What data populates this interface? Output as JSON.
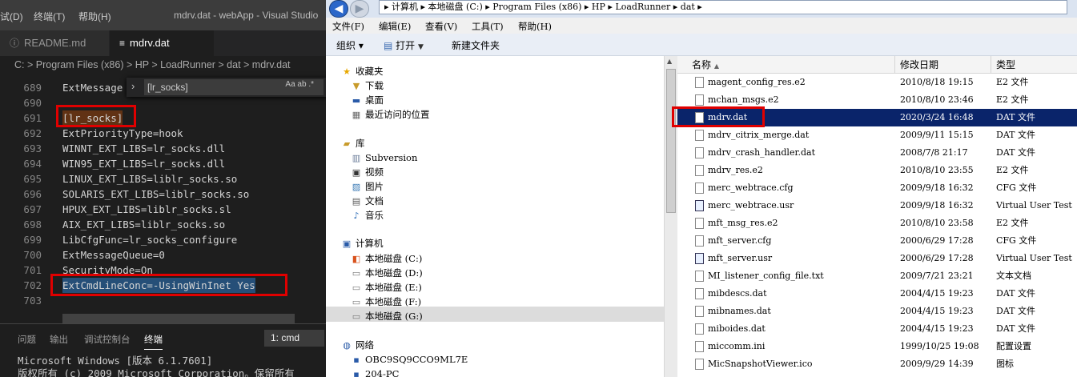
{
  "vscode": {
    "title_menus": [
      "试(D)",
      "终端(T)",
      "帮助(H)"
    ],
    "window_title": "mdrv.dat - webApp - Visual Studio",
    "tabs": [
      {
        "label": "README.md",
        "icon": "info-icon"
      },
      {
        "label": "mdrv.dat",
        "icon": "list-icon"
      }
    ],
    "breadcrumb": "C: > Program Files (x86) > HP > LoadRunner > dat > mdrv.dat",
    "find_text": "[lr_socks]",
    "find_options": "Aa  ab  .*",
    "lines": [
      {
        "n": "689",
        "code": "ExtMessage"
      },
      {
        "n": "690",
        "code": ""
      },
      {
        "n": "691",
        "code": "[lr_socks]"
      },
      {
        "n": "692",
        "code": "ExtPriorityType=hook"
      },
      {
        "n": "693",
        "code": "WINNT_EXT_LIBS=lr_socks.dll"
      },
      {
        "n": "694",
        "code": "WIN95_EXT_LIBS=lr_socks.dll"
      },
      {
        "n": "695",
        "code": "LINUX_EXT_LIBS=liblr_socks.so"
      },
      {
        "n": "696",
        "code": "SOLARIS_EXT_LIBS=liblr_socks.so"
      },
      {
        "n": "697",
        "code": "HPUX_EXT_LIBS=liblr_socks.sl"
      },
      {
        "n": "698",
        "code": "AIX_EXT_LIBS=liblr_socks.so"
      },
      {
        "n": "699",
        "code": "LibCfgFunc=lr_socks_configure"
      },
      {
        "n": "700",
        "code": "ExtMessageQueue=0"
      },
      {
        "n": "701",
        "code": "SecurityMode=On"
      },
      {
        "n": "702",
        "code": "ExtCmdLineConc=-UsingWinInet Yes"
      },
      {
        "n": "703",
        "code": ""
      }
    ],
    "panel_tabs": [
      "问题",
      "输出",
      "调试控制台",
      "终端"
    ],
    "terminal_select": "1: cmd",
    "terminal_lines": [
      "Microsoft Windows [版本 6.1.7601]",
      "版权所有 (c) 2009 Microsoft Corporation。保留所有"
    ]
  },
  "explorer": {
    "address_path": "▸ 计算机 ▸ 本地磁盘 (C:) ▸ Program Files (x86) ▸ HP ▸ LoadRunner ▸ dat ▸",
    "menus": [
      "文件(F)",
      "编辑(E)",
      "查看(V)",
      "工具(T)",
      "帮助(H)"
    ],
    "toolbar": {
      "organize": "组织 ▾",
      "open": "打开",
      "new_folder": "新建文件夹"
    },
    "nav": {
      "favorites_title": "收藏夹",
      "favorites": [
        "下载",
        "桌面",
        "最近访问的位置"
      ],
      "libraries_title": "库",
      "libraries": [
        "Subversion",
        "视频",
        "图片",
        "文档",
        "音乐"
      ],
      "computer_title": "计算机",
      "drives": [
        "本地磁盘 (C:)",
        "本地磁盘 (D:)",
        "本地磁盘 (E:)",
        "本地磁盘 (F:)",
        "本地磁盘 (G:)"
      ],
      "network_title": "网络",
      "network": [
        "OBC9SQ9CCO9ML7E",
        "204-PC"
      ]
    },
    "columns": {
      "name": "名称",
      "date": "修改日期",
      "type": "类型"
    },
    "files": [
      {
        "name": "magent_config_res.e2",
        "date": "2010/8/18 19:15",
        "type": "E2 文件",
        "icon": "file-icon"
      },
      {
        "name": "mchan_msgs.e2",
        "date": "2010/8/10 23:46",
        "type": "E2 文件",
        "icon": "file-icon"
      },
      {
        "name": "mdrv.dat",
        "date": "2020/3/24 16:48",
        "type": "DAT 文件",
        "icon": "file-icon"
      },
      {
        "name": "mdrv_citrix_merge.dat",
        "date": "2009/9/11 15:15",
        "type": "DAT 文件",
        "icon": "file-icon"
      },
      {
        "name": "mdrv_crash_handler.dat",
        "date": "2008/7/8 21:17",
        "type": "DAT 文件",
        "icon": "file-icon"
      },
      {
        "name": "mdrv_res.e2",
        "date": "2010/8/10 23:55",
        "type": "E2 文件",
        "icon": "file-icon"
      },
      {
        "name": "merc_webtrace.cfg",
        "date": "2009/9/18 16:32",
        "type": "CFG 文件",
        "icon": "file-icon"
      },
      {
        "name": "merc_webtrace.usr",
        "date": "2009/9/18 16:32",
        "type": "Virtual User Test",
        "icon": "vuser-icon"
      },
      {
        "name": "mft_msg_res.e2",
        "date": "2010/8/10 23:58",
        "type": "E2 文件",
        "icon": "file-icon"
      },
      {
        "name": "mft_server.cfg",
        "date": "2000/6/29 17:28",
        "type": "CFG 文件",
        "icon": "file-icon"
      },
      {
        "name": "mft_server.usr",
        "date": "2000/6/29 17:28",
        "type": "Virtual User Test",
        "icon": "vuser-icon"
      },
      {
        "name": "MI_listener_config_file.txt",
        "date": "2009/7/21 23:21",
        "type": "文本文档",
        "icon": "file-icon"
      },
      {
        "name": "mibdescs.dat",
        "date": "2004/4/15 19:23",
        "type": "DAT 文件",
        "icon": "file-icon"
      },
      {
        "name": "mibnames.dat",
        "date": "2004/4/15 19:23",
        "type": "DAT 文件",
        "icon": "file-icon"
      },
      {
        "name": "miboides.dat",
        "date": "2004/4/15 19:23",
        "type": "DAT 文件",
        "icon": "file-icon"
      },
      {
        "name": "miccomm.ini",
        "date": "1999/10/25 19:08",
        "type": "配置设置",
        "icon": "settings-icon"
      },
      {
        "name": "MicSnapshotViewer.ico",
        "date": "2009/9/29 14:39",
        "type": "图标",
        "icon": "image-icon"
      }
    ]
  },
  "colors": {
    "highlight_red": "#e00000",
    "selection_blue": "#0a246a"
  }
}
